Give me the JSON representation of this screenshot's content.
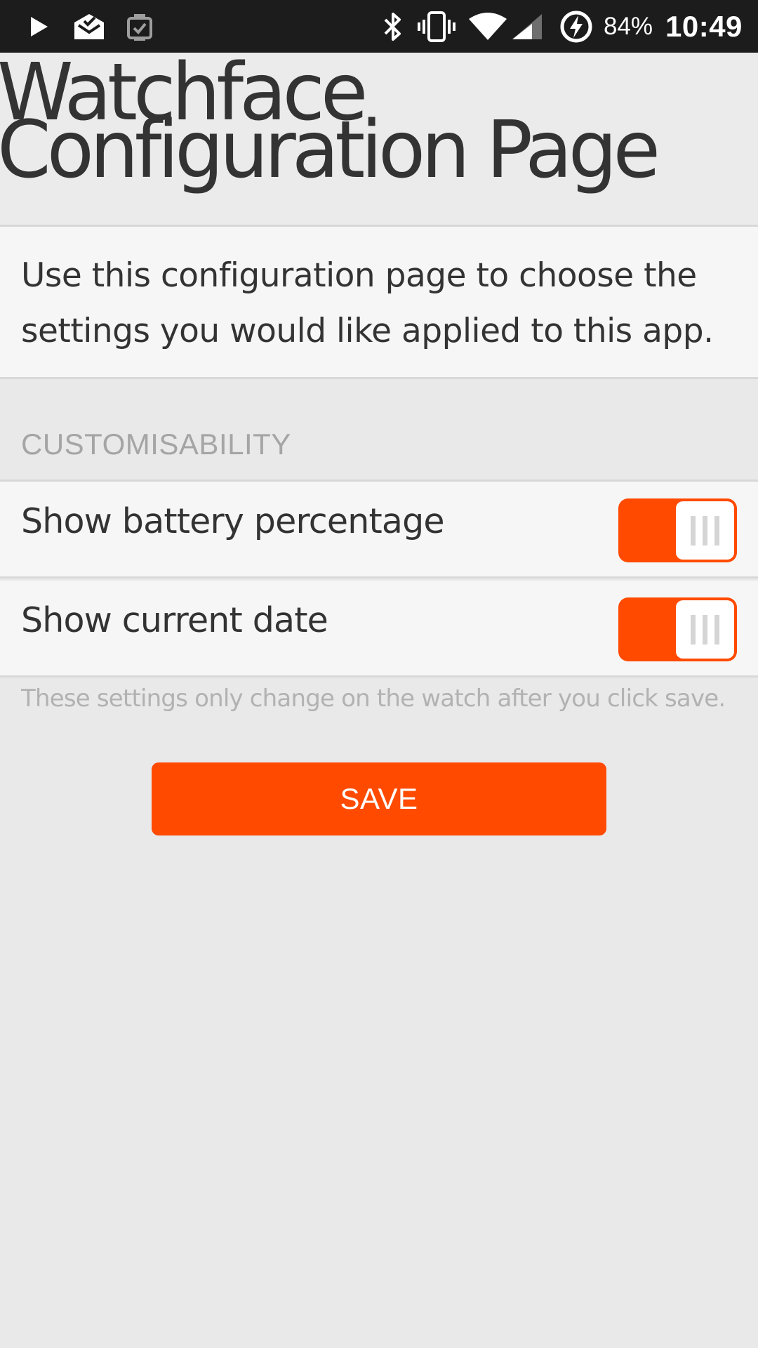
{
  "status_bar": {
    "icons": [
      "play-store-icon",
      "mail-icon",
      "watch-app-icon",
      "bluetooth-icon",
      "vibrate-icon",
      "wifi-icon",
      "cell-signal-icon",
      "battery-charging-icon"
    ],
    "battery_percent": "84%",
    "time": "10:49"
  },
  "header": {
    "title": "Watchface\nConfiguration Page"
  },
  "intro": {
    "text": "Use this configuration page to choose the settings you would like applied to this app."
  },
  "section": {
    "heading": "CUSTOMISABILITY"
  },
  "settings": [
    {
      "label": "Show battery percentage",
      "enabled": true
    },
    {
      "label": "Show current date",
      "enabled": true
    }
  ],
  "note": "These settings only change on the watch after you click save.",
  "save_button": {
    "label": "SAVE"
  },
  "colors": {
    "accent": "#ff4a00",
    "status_bar": "#1c1c1c",
    "background": "#e9e9e9",
    "card": "#f6f6f6",
    "text": "#333333",
    "muted_text": "#a5a5a5"
  }
}
